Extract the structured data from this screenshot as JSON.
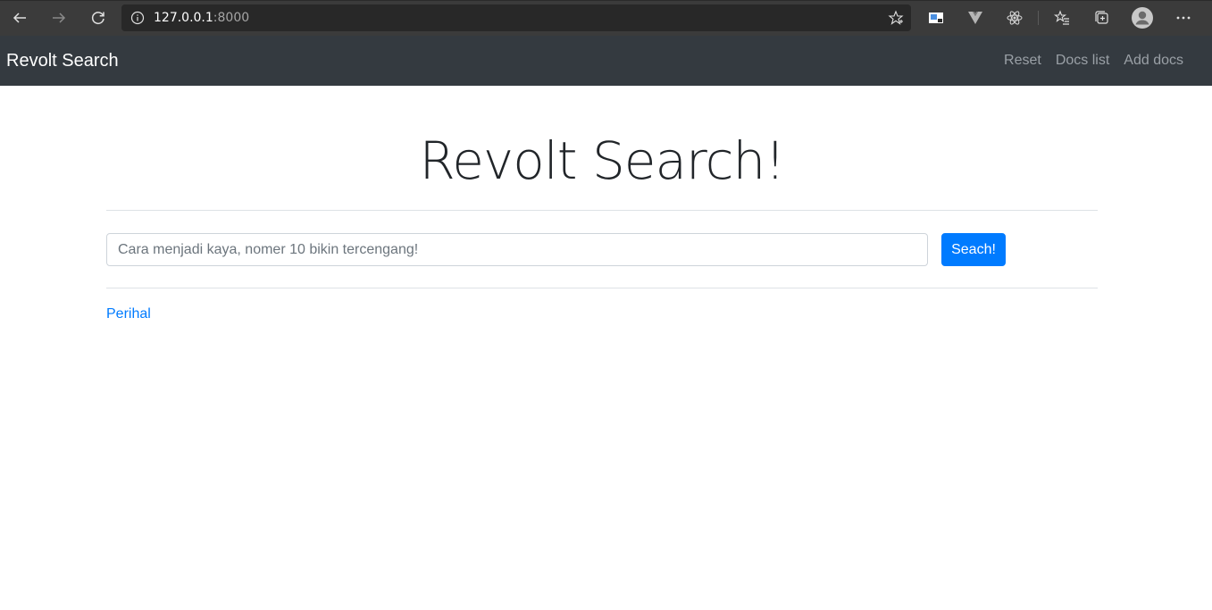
{
  "browser": {
    "url_host": "127.0.0.1",
    "url_port": ":8000",
    "icons": {
      "back": "arrow-left-icon",
      "forward": "arrow-right-icon",
      "reload": "reload-icon",
      "info": "info-icon",
      "favorite": "star-icon",
      "extensions": [
        "screenshot-extension-icon",
        "vue-devtools-icon",
        "react-devtools-icon"
      ],
      "favorites_bar": "favorites-icon",
      "collections": "collections-icon",
      "profile": "profile-avatar-icon",
      "menu": "more-menu-icon"
    }
  },
  "navbar": {
    "brand": "Revolt Search",
    "links": [
      "Reset",
      "Docs list",
      "Add docs"
    ]
  },
  "main": {
    "title": "Revolt Search!",
    "search": {
      "placeholder": "Cara menjadi kaya, nomer 10 bikin tercengang!",
      "value": ""
    },
    "search_button": "Seach!",
    "link": "Perihal"
  },
  "colors": {
    "navbar_bg": "#343a40",
    "primary": "#007bff",
    "link_muted": "#9aa0a6",
    "browser_bg": "#3b3b3b"
  }
}
